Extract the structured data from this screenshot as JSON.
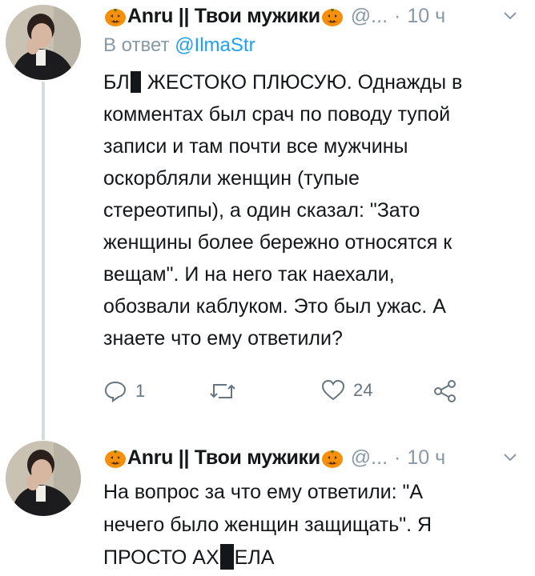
{
  "tweets": [
    {
      "name": "Anru || Твои мужики",
      "handle": "@...",
      "separator": "·",
      "time": "10 ч",
      "reply_prefix": "В ответ",
      "reply_mention": "@IlmaStr",
      "text_part1": "БЛ",
      "text_part2": " ЖЕСТОКО ПЛЮСУЮ. Однажды в\nкомментах был срач по поводу тупой\nзаписи и там почти все мужчины\nоскорбляли женщин (тупые\nстереотипы), а один сказал: \"Зато\nженщины более бережно относятся к\nвещам\". И на него так наехали,\nобозвали каблуком. Это был ужас. А\nзнаете что ему ответили?",
      "reply_count": "1",
      "like_count": "24"
    },
    {
      "name": "Anru || Твои мужики",
      "handle": "@...",
      "separator": "·",
      "time": "10 ч",
      "text_part1": "На вопрос за что ему ответили: \"А\nнечего было женщин защищать\". Я\nПРОСТО АХ",
      "text_part2": "ЕЛА"
    }
  ],
  "colors": {
    "text": "#14171a",
    "secondary": "#8899a6",
    "link": "#1da1f2",
    "thread_line": "#d5dbe0",
    "icon": "#66757f"
  },
  "icons": [
    "pumpkin-emoji",
    "chevron-down-icon",
    "reply-icon",
    "retweet-icon",
    "like-icon",
    "share-icon"
  ]
}
